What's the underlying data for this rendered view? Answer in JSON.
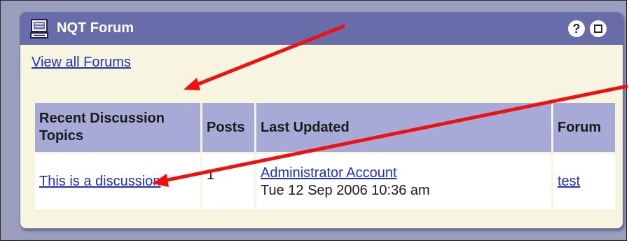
{
  "window": {
    "title": "NQT Forum",
    "title_icon": "forum-icon",
    "help_label": "?",
    "buttons": {
      "help_icon": "help-icon",
      "maximize_icon": "maximize-icon"
    }
  },
  "links": {
    "view_all": "View all Forums"
  },
  "table": {
    "headers": [
      "Recent Discussion Topics",
      "Posts",
      "Last Updated",
      "Forum"
    ],
    "rows": [
      {
        "topic": "This is a discussion",
        "posts": "1",
        "updated_by": "Administrator Account",
        "updated_at": "Tue 12 Sep 2006 10:36 am",
        "forum": "test"
      }
    ]
  },
  "colors": {
    "titlebar": "#686ca8",
    "header_cell": "#a7a9d7",
    "panel_bg": "#f7f5e0",
    "link": "#2231b8",
    "annotation_arrow": "#ee1111"
  }
}
